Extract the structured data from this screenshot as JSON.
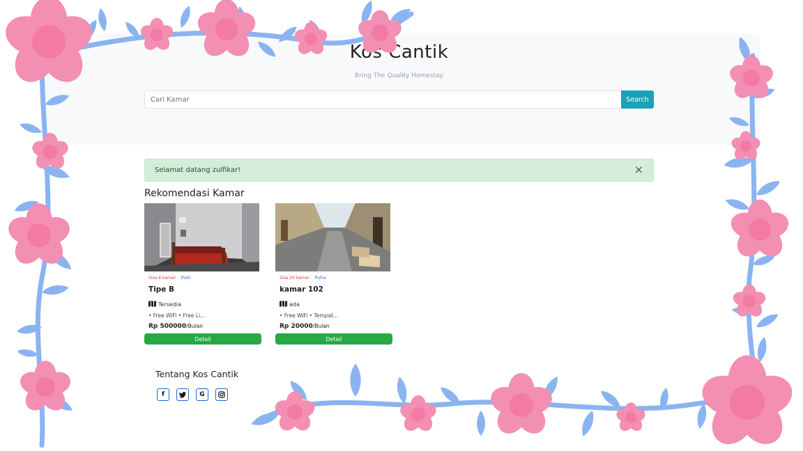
{
  "header": {
    "title": "Kos Cantik",
    "tagline": "Bring The Quality Homestay"
  },
  "search": {
    "placeholder": "Cari Kamar",
    "button_label": "Search"
  },
  "alert": {
    "message": "Selamat datang zulfikar!",
    "close_symbol": "×"
  },
  "section": {
    "title": "Rekomendasi Kamar"
  },
  "rooms": [
    {
      "stock": "Sisa 4 kamar",
      "gender": "Putri",
      "name": "Tipe B",
      "address": "Tersedia",
      "features": "• Free WiFi • Free Li...",
      "price": "Rp 500000",
      "unit": "/Bulan",
      "button": "Detail"
    },
    {
      "stock": "Sisa 20 kamar",
      "gender": "Putra",
      "name": "kamar 102",
      "address": "ada",
      "features": "• Free WiFi • Tempat...",
      "price": "Rp 20000",
      "unit": "/Bulan",
      "button": "Detail"
    }
  ],
  "footer": {
    "title": "Tentang Kos Cantik",
    "social": [
      "facebook-icon",
      "twitter-icon",
      "google-icon",
      "instagram-icon"
    ]
  },
  "colors": {
    "search_button": "#17a2b8",
    "detail_button": "#28a745",
    "alert_bg": "#d4edda",
    "stock_badge": "#e53935",
    "gender_badge": "#1e63d6",
    "frame_leaf": "#8ab4f0",
    "frame_flower": "#f38fb3"
  }
}
